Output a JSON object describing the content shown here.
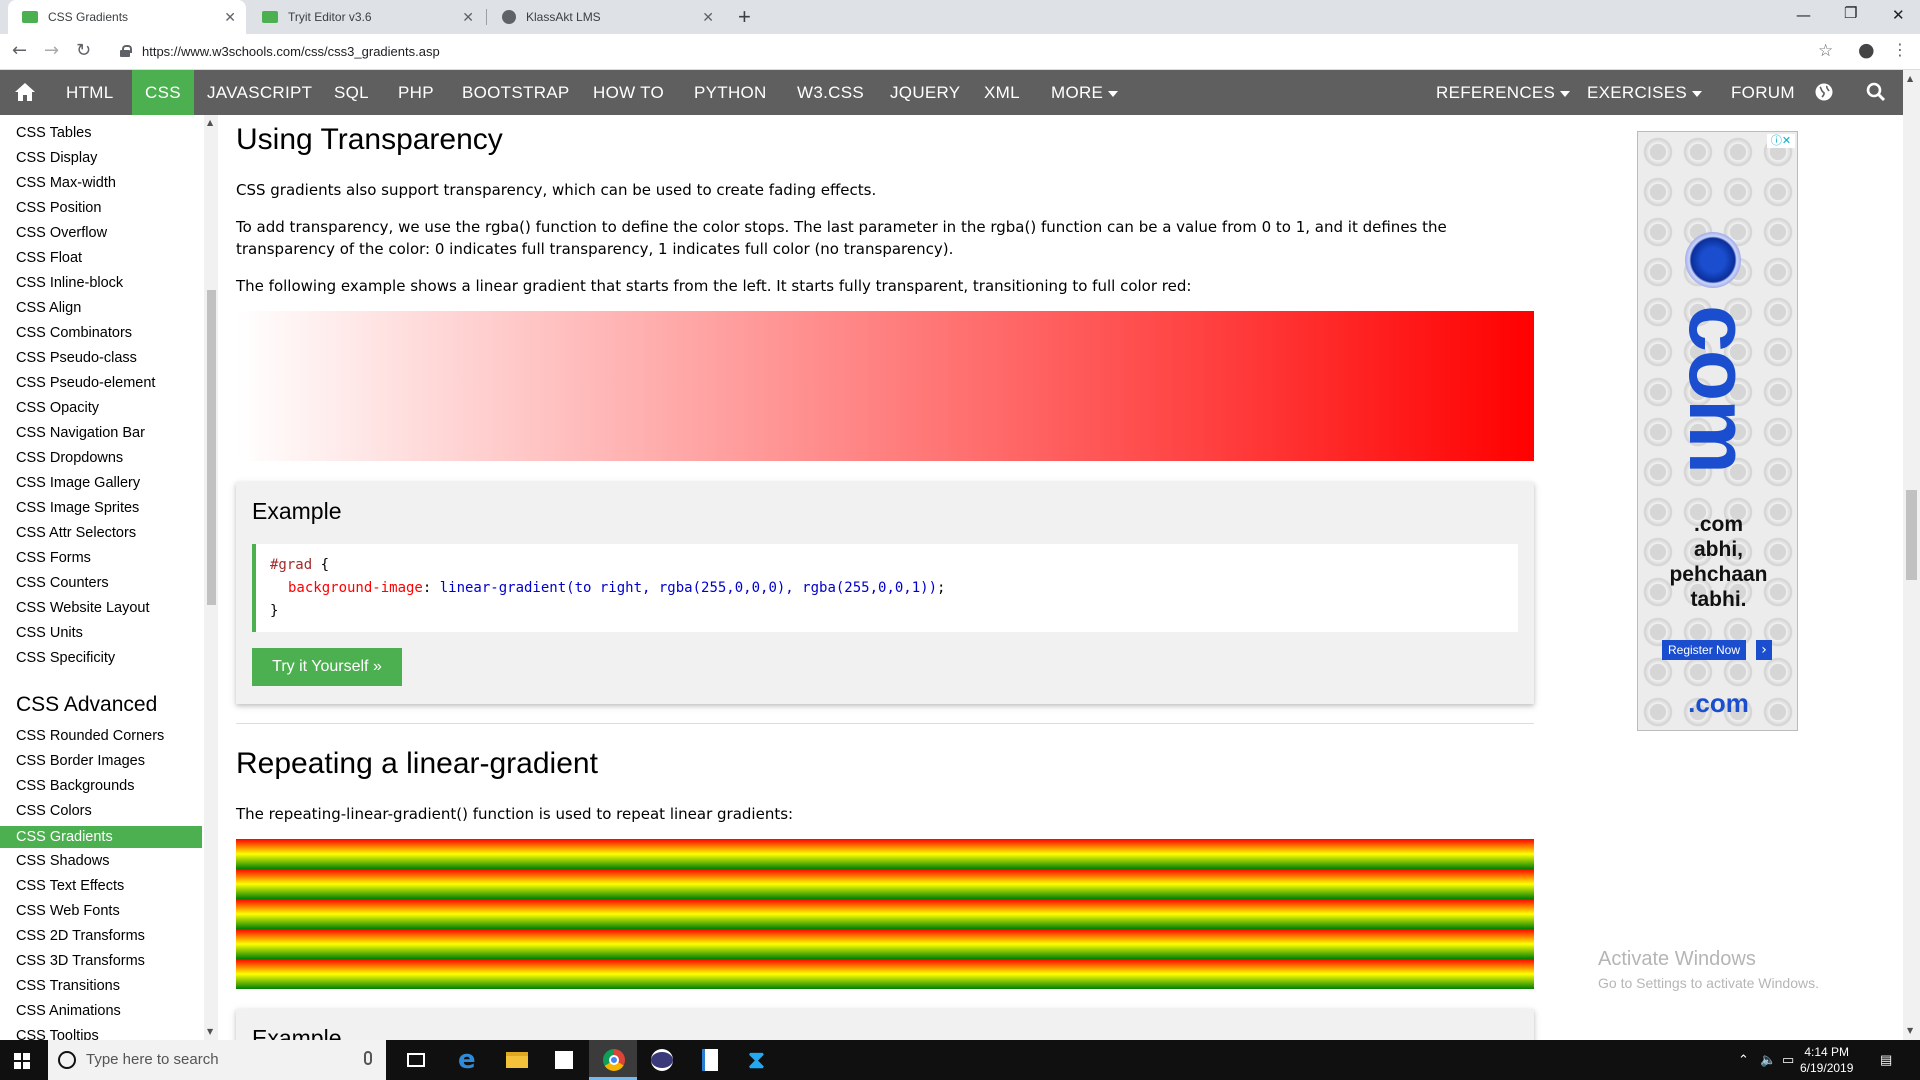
{
  "browser": {
    "tabs": [
      {
        "title": "CSS Gradients",
        "active": true
      },
      {
        "title": "Tryit Editor v3.6",
        "active": false
      },
      {
        "title": "KlassAkt LMS",
        "active": false
      }
    ],
    "url": "https://www.w3schools.com/css/css3_gradients.asp"
  },
  "topnav": {
    "items": [
      "HTML",
      "CSS",
      "JAVASCRIPT",
      "SQL",
      "PHP",
      "BOOTSTRAP",
      "HOW TO",
      "PYTHON",
      "W3.CSS",
      "JQUERY",
      "XML",
      "MORE"
    ],
    "active": "CSS",
    "right_items": [
      "REFERENCES",
      "EXERCISES",
      "FORUM"
    ]
  },
  "sidebar": {
    "items1": [
      "CSS Tables",
      "CSS Display",
      "CSS Max-width",
      "CSS Position",
      "CSS Overflow",
      "CSS Float",
      "CSS Inline-block",
      "CSS Align",
      "CSS Combinators",
      "CSS Pseudo-class",
      "CSS Pseudo-element",
      "CSS Opacity",
      "CSS Navigation Bar",
      "CSS Dropdowns",
      "CSS Image Gallery",
      "CSS Image Sprites",
      "CSS Attr Selectors",
      "CSS Forms",
      "CSS Counters",
      "CSS Website Layout",
      "CSS Units",
      "CSS Specificity"
    ],
    "heading": "CSS Advanced",
    "items2": [
      "CSS Rounded Corners",
      "CSS Border Images",
      "CSS Backgrounds",
      "CSS Colors",
      "CSS Gradients",
      "CSS Shadows",
      "CSS Text Effects",
      "CSS Web Fonts",
      "CSS 2D Transforms",
      "CSS 3D Transforms",
      "CSS Transitions",
      "CSS Animations",
      "CSS Tooltips"
    ],
    "active": "CSS Gradients"
  },
  "main": {
    "heading1": "Using Transparency",
    "p1": "CSS gradients also support transparency, which can be used to create fading effects.",
    "p2": "To add transparency, we use the rgba() function to define the color stops. The last parameter in the rgba() function can be a value from 0 to 1, and it defines the transparency of the color: 0 indicates full transparency, 1 indicates full color (no transparency).",
    "p3": "The following example shows a linear gradient that starts from the left. It starts fully transparent, transitioning to full color red:",
    "example_title": "Example",
    "code_selector": "#grad",
    "code_brace_open": " {",
    "code_property": "background-image",
    "code_colon": ": ",
    "code_value": "linear-gradient(to right, rgba(255,0,0,0), rgba(255,0,0,1))",
    "code_semicolon": ";",
    "code_brace_close": "}",
    "try_label": "Try it Yourself »",
    "heading2": "Repeating a linear-gradient",
    "p4": "The repeating-linear-gradient() function is used to repeat linear gradients:",
    "example2_title": "Example"
  },
  "ad": {
    "big_text": "com",
    "tagline": [
      ".com",
      "abhi,",
      "pehchaan",
      "tabhi."
    ],
    "register": "Register Now",
    "footer": ".com"
  },
  "activate": {
    "title": "Activate Windows",
    "sub": "Go to Settings to activate Windows."
  },
  "taskbar": {
    "search_placeholder": "Type here to search",
    "time": "4:14 PM",
    "date": "6/19/2019"
  },
  "colors": {
    "accent": "#4CAF50",
    "nav": "#5f5f5f",
    "ad_blue": "#1b4ecf"
  }
}
